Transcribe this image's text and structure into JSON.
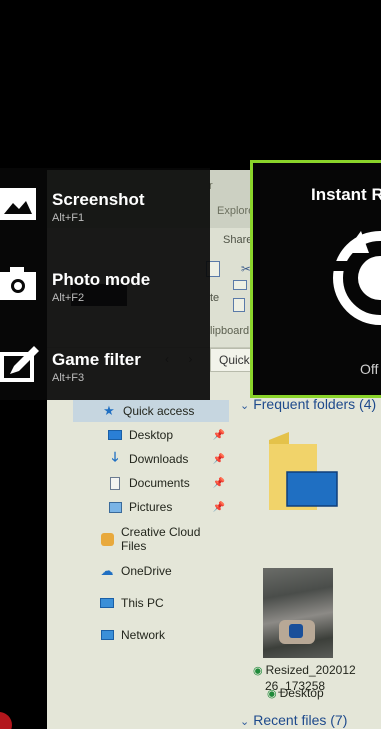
{
  "explorer": {
    "title_fragment": "r",
    "title_fragment2": "Explorer",
    "tab_share": "Share",
    "ribbon_group": "lipboard",
    "ribbon_label_paste": "te",
    "address": "Quick",
    "nav_items": [
      {
        "label": "Quick access",
        "icon": "quick-access-star-icon",
        "pinned": false,
        "selected": true
      },
      {
        "label": "Desktop",
        "icon": "desktop-icon",
        "pinned": true,
        "selected": false
      },
      {
        "label": "Downloads",
        "icon": "downloads-icon",
        "pinned": true,
        "selected": false
      },
      {
        "label": "Documents",
        "icon": "documents-icon",
        "pinned": true,
        "selected": false
      },
      {
        "label": "Pictures",
        "icon": "pictures-icon",
        "pinned": true,
        "selected": false
      },
      {
        "label": "Creative Cloud Files",
        "icon": "creative-cloud-icon",
        "pinned": false,
        "selected": false
      },
      {
        "label": "OneDrive",
        "icon": "onedrive-icon",
        "pinned": false,
        "selected": false
      },
      {
        "label": "This PC",
        "icon": "this-pc-icon",
        "pinned": false,
        "selected": false
      },
      {
        "label": "Network",
        "icon": "network-icon",
        "pinned": false,
        "selected": false
      }
    ],
    "frequent_folders_label": "Frequent folders (4)",
    "frequent_folder_item": "Desktop",
    "recent_files_label": "Recent files (7)",
    "recent_file_name_line1": "Resized_202012",
    "recent_file_name_line2": "26_173258"
  },
  "widget_menu": {
    "items": [
      {
        "title": "Screenshot",
        "shortcut": "Alt+F1",
        "icon": "screenshot-icon"
      },
      {
        "title": "Photo mode",
        "shortcut": "Alt+F2",
        "icon": "camera-icon"
      },
      {
        "title": "Game filter",
        "shortcut": "Alt+F3",
        "icon": "filter-edit-icon"
      }
    ]
  },
  "replay_panel": {
    "title": "Instant R",
    "status": "Off",
    "icon": "instant-replay-icon",
    "accent_color": "#8ad42a"
  }
}
